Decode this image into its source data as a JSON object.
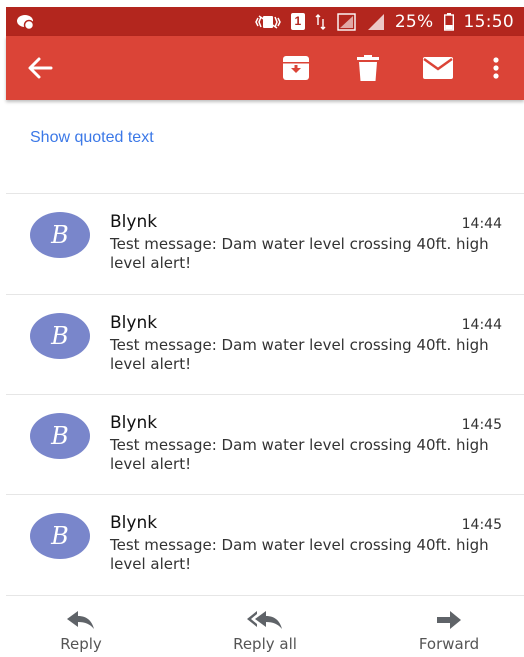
{
  "status_bar": {
    "battery": "25%",
    "time": "15:50",
    "sim_badge": "1"
  },
  "app_bar": {
    "color": "#db4437",
    "actions": [
      "back-arrow-icon",
      "archive-icon",
      "delete-icon",
      "mark-unread-icon",
      "more-vert-icon"
    ]
  },
  "thread": {
    "show_quoted_text": "Show quoted text",
    "messages": [
      {
        "avatar_letter": "B",
        "sender": "Blynk",
        "time": "14:44",
        "body": "Test message: Dam water level crossing 40ft. high level alert!"
      },
      {
        "avatar_letter": "B",
        "sender": "Blynk",
        "time": "14:44",
        "body": "Test message: Dam water level crossing 40ft. high level alert!"
      },
      {
        "avatar_letter": "B",
        "sender": "Blynk",
        "time": "14:45",
        "body": "Test message: Dam water level crossing 40ft. high level alert!"
      },
      {
        "avatar_letter": "B",
        "sender": "Blynk",
        "time": "14:45",
        "body": "Test message: Dam water level crossing 40ft. high level alert!"
      }
    ]
  },
  "bottom_actions": {
    "reply": "Reply",
    "reply_all": "Reply all",
    "forward": "Forward"
  },
  "colors": {
    "status_bar": "#b3261e",
    "link": "#3b78e7",
    "avatar": "#7986cb"
  }
}
